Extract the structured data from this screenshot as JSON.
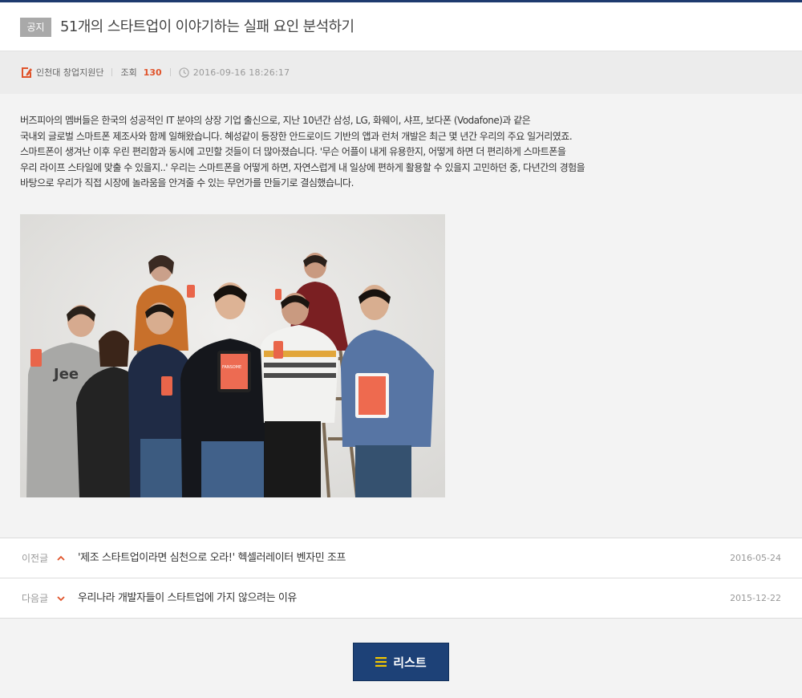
{
  "post": {
    "badge": "공지",
    "title": "51개의 스타트업이 이야기하는 실패 요인 분석하기",
    "author": "인천대 창업지원단",
    "views_label": "조회",
    "views": "130",
    "datetime": "2016-09-16 18:26:17",
    "body": [
      "버즈피아의 멤버들은 한국의 성공적인 IT 분야의 상장 기업 출신으로, 지난 10년간 삼성, LG, 화웨이, 샤프, 보다폰 (Vodafone)과 같은",
      "국내외 글로벌 스마트폰 제조사와 함께 일해왔습니다. 혜성같이 등장한 안드로이드 기반의 앱과 런처 개발은 최근 몇 년간 우리의 주요 일거리였죠.",
      "스마트폰이 생겨난 이후 우린 편리함과 동시에 고민할 것들이 더 많아졌습니다. '무슨 어플이 내게 유용한지, 어떻게 하면 더 편리하게 스마트폰을",
      "우리 라이프 스타일에 맞출 수 있을지..' 우리는 스마트폰을 어떻게 하면, 자연스럽게 내 일상에 편하게 활용할 수 있을지 고민하던 중, 다년간의 경험을",
      "바탕으로 우리가 직접 시장에 놀라움을 안겨줄 수 있는 무언가를 만들기로 결심했습니다."
    ],
    "photo_tablet_text": "FANSOME"
  },
  "navigation": {
    "prev": {
      "label": "이전글",
      "title": "'제조 스타트업이라면 심천으로 오라!' 헥셀러레이터 벤자민 조프",
      "date": "2016-05-24"
    },
    "next": {
      "label": "다음글",
      "title": "우리나라 개발자들이 스타트업에 가지 않으려는 이유",
      "date": "2015-12-22"
    }
  },
  "footer": {
    "list_button": "리스트"
  },
  "colors": {
    "accent": "#e0532a",
    "button": "#1d4177",
    "top_line": "#1e3a6e"
  }
}
